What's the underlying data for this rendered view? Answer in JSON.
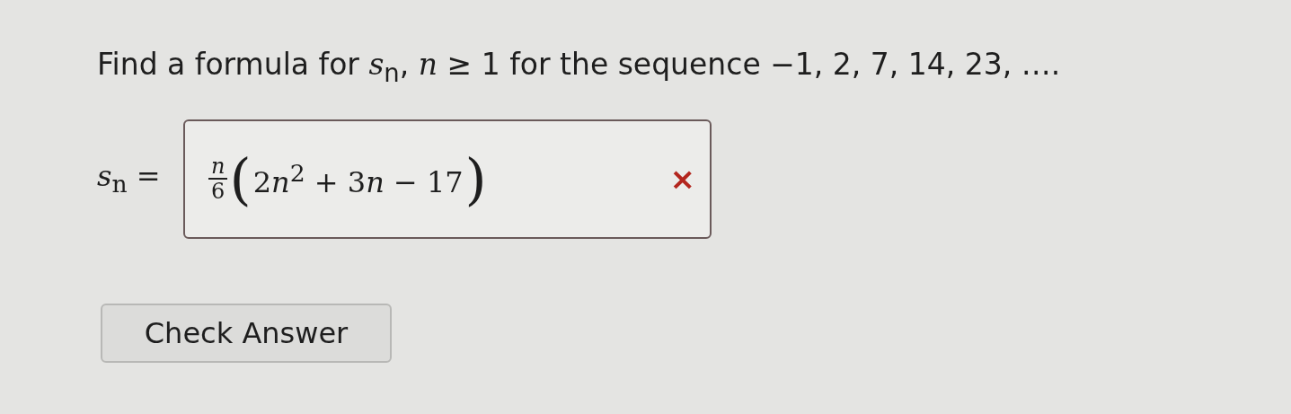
{
  "question": "Find a formula for *s*$_{n}$, *n* ≥ 1 for the sequence −1, 2, 7, 14, 23, ….",
  "answer": {
    "label": "*s*$_{n}$ =",
    "numerator": "n",
    "denominator": "6",
    "paren_open": "(",
    "expression": [
      {
        "kind": "text",
        "text": "2"
      },
      {
        "kind": "var",
        "text": "n"
      },
      {
        "kind": "sup",
        "text": "2"
      },
      {
        "kind": "text",
        "text": " + 3"
      },
      {
        "kind": "var",
        "text": "n"
      },
      {
        "kind": "text",
        "text": " − 17"
      }
    ],
    "paren_close": ")",
    "correct": false,
    "mark": "×"
  },
  "buttons": [
    {
      "label": "Check Answer"
    }
  ]
}
